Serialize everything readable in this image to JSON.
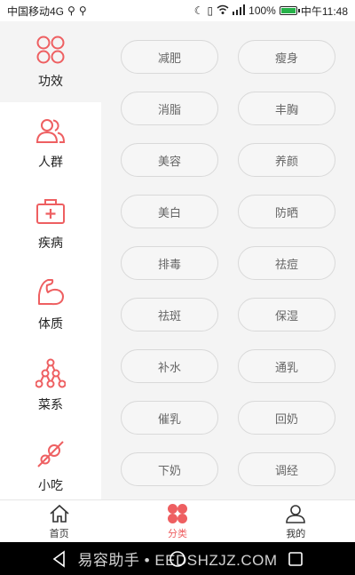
{
  "status_bar": {
    "carrier": "中国移动4G",
    "battery_percent": "100%",
    "battery_level": 1.0,
    "time": "中午11:48"
  },
  "sidebar": {
    "items": [
      {
        "label": "功效",
        "icon": "four-circles-icon",
        "active": true
      },
      {
        "label": "人群",
        "icon": "people-icon",
        "active": false
      },
      {
        "label": "疾病",
        "icon": "medical-kit-icon",
        "active": false
      },
      {
        "label": "体质",
        "icon": "muscle-arm-icon",
        "active": false
      },
      {
        "label": "菜系",
        "icon": "tree-network-icon",
        "active": false
      },
      {
        "label": "小吃",
        "icon": "skewer-icon",
        "active": false
      }
    ]
  },
  "tags": [
    "减肥",
    "瘦身",
    "消脂",
    "丰胸",
    "美容",
    "养颜",
    "美白",
    "防晒",
    "排毒",
    "祛痘",
    "祛斑",
    "保湿",
    "补水",
    "通乳",
    "催乳",
    "回奶",
    "下奶",
    "调经"
  ],
  "bottom_nav": {
    "items": [
      {
        "label": "首页",
        "icon": "home-icon"
      },
      {
        "label": "分类",
        "icon": "category-icon"
      },
      {
        "label": "我的",
        "icon": "user-icon"
      }
    ]
  },
  "watermark": "易容助手 • EEDSHZJZ.COM",
  "colors": {
    "accent": "#ee5f61",
    "content_bg": "#f4f4f4",
    "tag_border": "#d9d9d9",
    "battery": "#27b24a"
  }
}
